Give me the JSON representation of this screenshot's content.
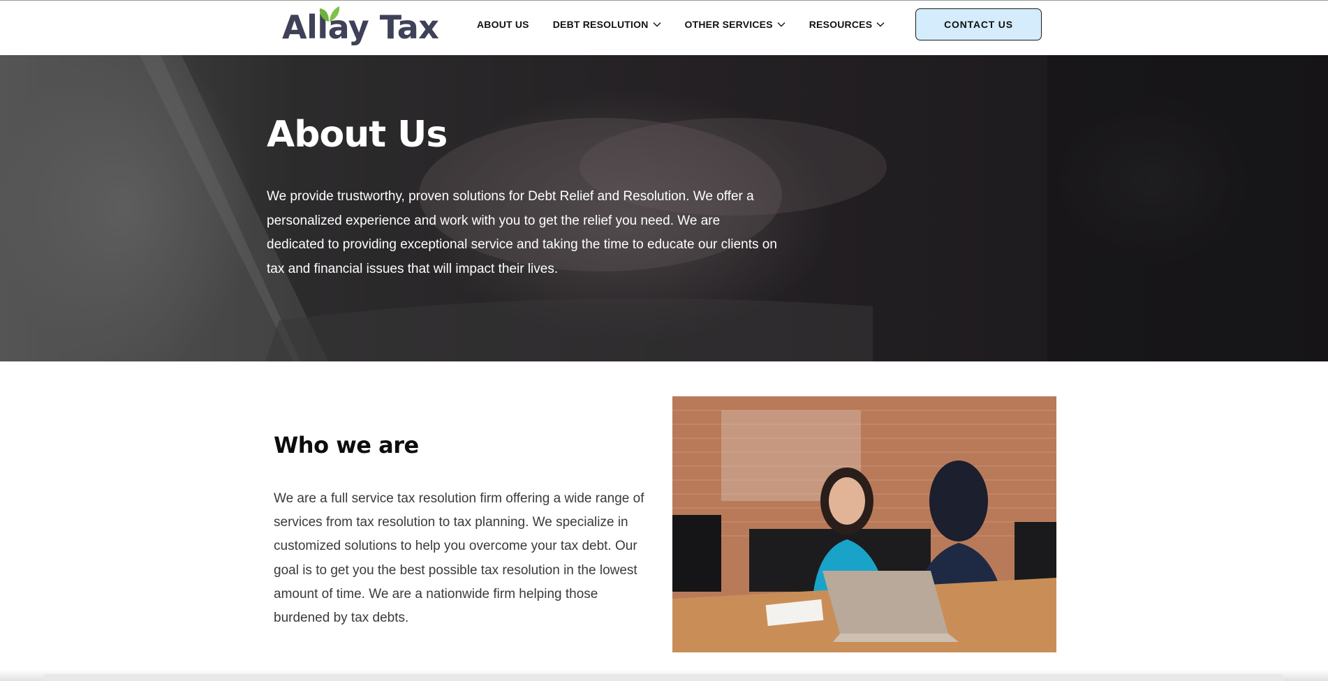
{
  "header": {
    "logo_text": "Allay Tax",
    "logo_icon": "leaf-icon",
    "nav": [
      {
        "label": "ABOUT US",
        "has_dropdown": false
      },
      {
        "label": "DEBT RESOLUTION",
        "has_dropdown": true
      },
      {
        "label": "OTHER SERVICES",
        "has_dropdown": true
      },
      {
        "label": "RESOURCES",
        "has_dropdown": true
      }
    ],
    "contact_label": "CONTACT US"
  },
  "hero": {
    "title": "About Us",
    "text": "We provide trustworthy, proven solutions for Debt Relief and Resolution. We offer a personalized experience and work with you to get the relief you need. We are dedicated to providing exceptional service and taking the time to educate our clients on tax and financial issues that will impact their lives."
  },
  "who": {
    "title": "Who we are",
    "text": "We are a full service tax resolution firm offering a wide range of services from tax resolution to tax planning. We specialize in customized solutions to help you overcome your tax debt. Our goal is to get you the best possible tax resolution in the lowest amount of time. We are a nationwide firm helping those burdened by tax debts."
  },
  "colors": {
    "logo": "#3e4157",
    "leaf": "#6cb33e",
    "contact_button_bg": "#d4ecfb",
    "hero_text": "#ffffff"
  }
}
